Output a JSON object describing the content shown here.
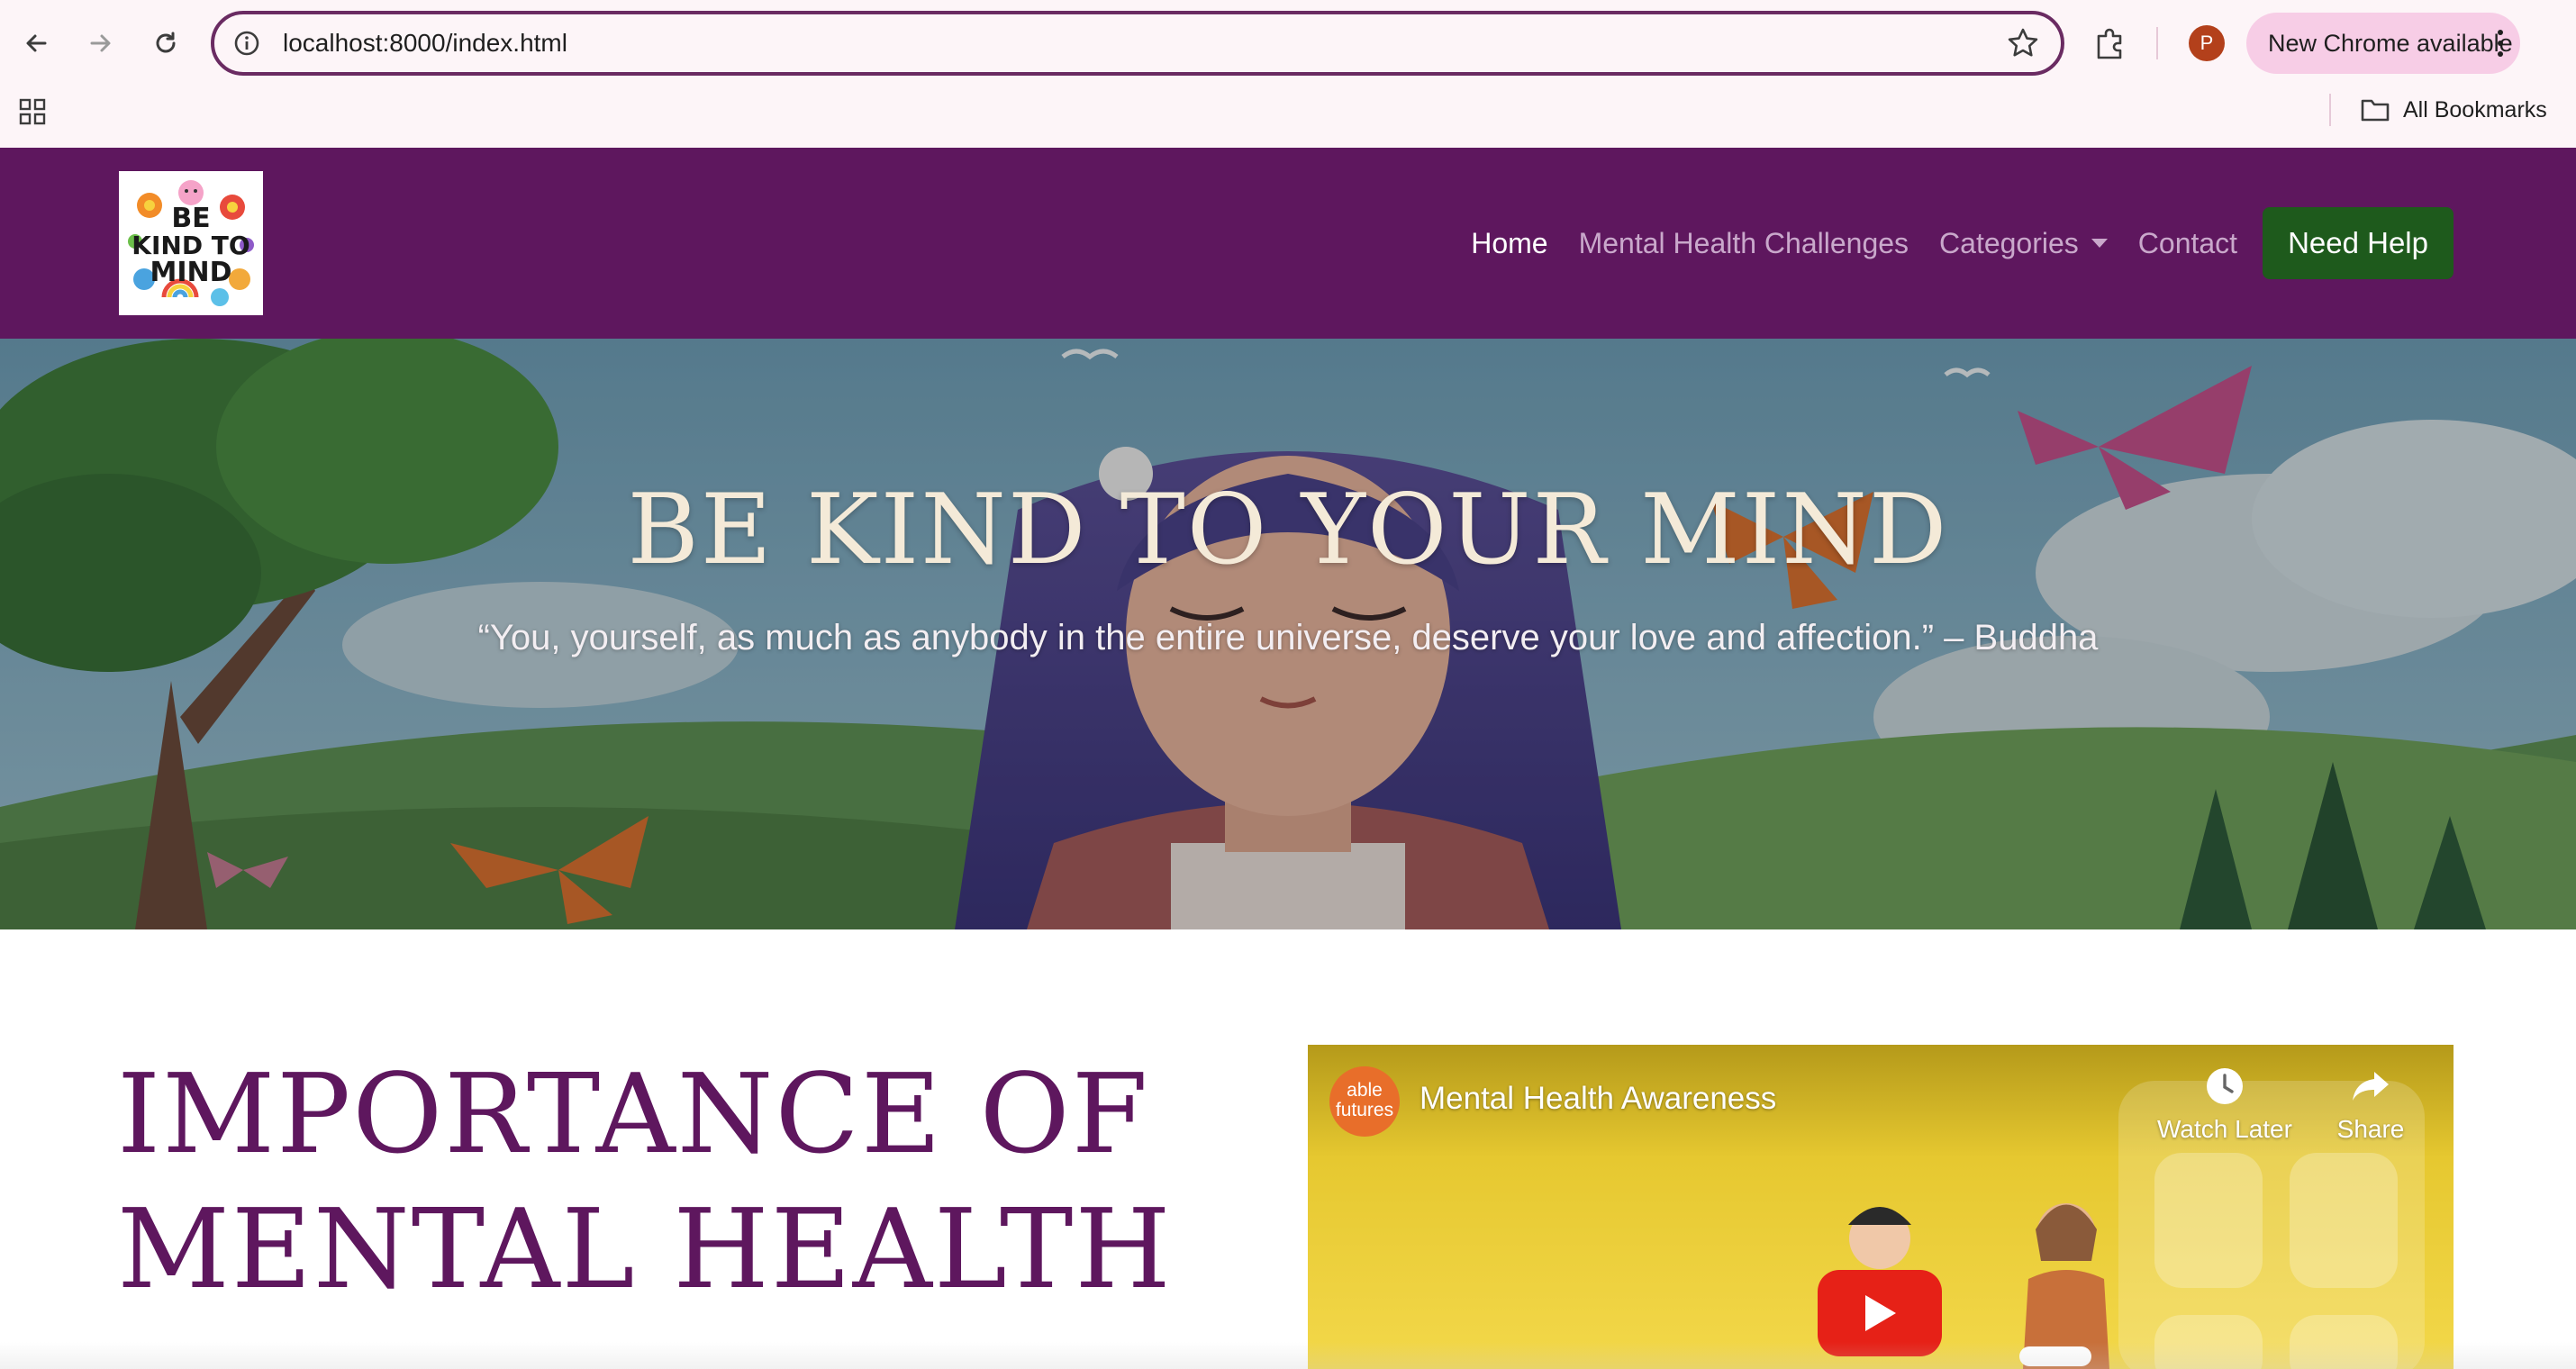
{
  "browser": {
    "url": "localhost:8000/index.html",
    "update_label": "New Chrome available",
    "profile_initial": "P",
    "bookmarks_label": "All Bookmarks",
    "accent_color": "#6a2b62"
  },
  "site": {
    "logo_alt": "BE KIND TO YOUR MIND",
    "nav": {
      "home": "Home",
      "challenges": "Mental Health Challenges",
      "categories": "Categories",
      "contact": "Contact",
      "help": "Need Help"
    },
    "brand_color": "#5e175e",
    "help_color": "#1e5a1c"
  },
  "hero": {
    "title": "BE KIND TO YOUR MIND",
    "quote": "“You, yourself, as much as anybody in the entire universe, deserve your love and affection.” – Buddha"
  },
  "main": {
    "heading_line1": "IMPORTANCE OF",
    "heading_line2": "MENTAL HEALTH"
  },
  "video": {
    "channel_line1": "able",
    "channel_line2": "futures",
    "title": "Mental Health Awareness",
    "watch_later": "Watch Later",
    "share": "Share"
  }
}
